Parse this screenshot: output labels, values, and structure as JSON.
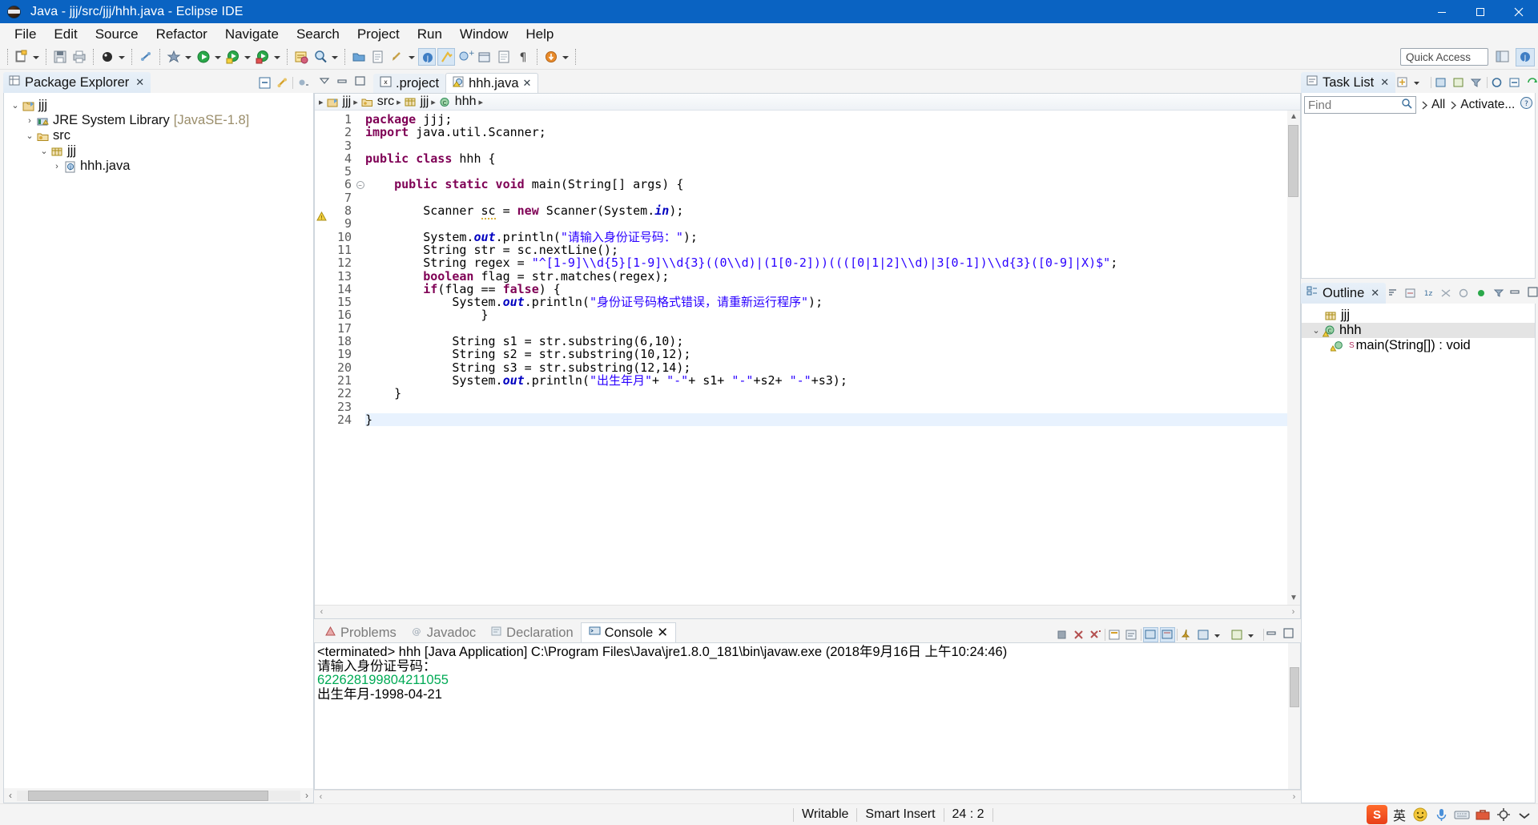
{
  "window": {
    "title": "Java - jjj/src/jjj/hhh.java - Eclipse IDE",
    "app_icon": "eclipse-icon",
    "minimize": "minimize-button",
    "maximize": "maximize-button",
    "close": "close-button",
    "titlebar_color": "#0a63c2"
  },
  "menu": {
    "items": [
      {
        "label": "File"
      },
      {
        "label": "Edit"
      },
      {
        "label": "Source"
      },
      {
        "label": "Refactor"
      },
      {
        "label": "Navigate"
      },
      {
        "label": "Search"
      },
      {
        "label": "Project"
      },
      {
        "label": "Run"
      },
      {
        "label": "Window"
      },
      {
        "label": "Help"
      }
    ]
  },
  "toolbar": {
    "quick_access_placeholder": "Quick Access",
    "icons": [
      "new-wizard-icon",
      "save-icon",
      "print-icon",
      "debug-icon",
      "link-icon",
      "build-icon",
      "run-last-icon",
      "debug-last-icon",
      "coverage-icon",
      "external-tools-icon",
      "search-icon",
      "open-type-icon",
      "next-annotation-icon",
      "previous-annotation-icon",
      "back-icon",
      "forward-icon",
      "java-perspective-icon",
      "toggle-breadcrumb-icon",
      "new-java-class-icon",
      "new-java-package-icon",
      "pilcrow-icon",
      "download-icon"
    ],
    "perspective_open": "open-perspective-icon",
    "perspective_java": "java-perspective-icon"
  },
  "package_explorer": {
    "title": "Package Explorer",
    "close_glyph": "✕",
    "actions": [
      "collapse-all-icon",
      "link-with-editor-icon",
      "view-menu-icon"
    ],
    "tree": [
      {
        "label": "jjj",
        "indent": 0,
        "twisty": "v",
        "icon": "java-project-icon",
        "suffix": ""
      },
      {
        "label": "JRE System Library",
        "indent": 1,
        "twisty": ">",
        "icon": "library-icon",
        "suffix": "[JavaSE-1.8]"
      },
      {
        "label": "src",
        "indent": 1,
        "twisty": "v",
        "icon": "source-folder-icon",
        "suffix": ""
      },
      {
        "label": "jjj",
        "indent": 2,
        "twisty": "v",
        "icon": "package-icon",
        "suffix": ""
      },
      {
        "label": "hhh.java",
        "indent": 3,
        "twisty": ">",
        "icon": "java-file-icon",
        "suffix": ""
      }
    ]
  },
  "editor": {
    "tabs": [
      {
        "label": ".project",
        "icon": "xml-file-icon",
        "active": false,
        "closable": false
      },
      {
        "label": "hhh.java",
        "icon": "java-warning-file-icon",
        "active": true,
        "closable": true
      }
    ],
    "breadcrumb": [
      {
        "label": "jjj",
        "icon": "java-project-icon"
      },
      {
        "label": "src",
        "icon": "source-folder-icon"
      },
      {
        "label": "jjj",
        "icon": "package-icon"
      },
      {
        "label": "hhh",
        "icon": "class-icon"
      }
    ],
    "current_line": 24,
    "lines": [
      {
        "n": 1,
        "fold": "",
        "marker": "",
        "tokens": [
          {
            "t": "package ",
            "c": "kw"
          },
          {
            "t": "jjj;",
            "c": ""
          }
        ]
      },
      {
        "n": 2,
        "fold": "",
        "marker": "",
        "tokens": [
          {
            "t": "import ",
            "c": "kw"
          },
          {
            "t": "java.util.Scanner;",
            "c": ""
          }
        ]
      },
      {
        "n": 3,
        "fold": "",
        "marker": "",
        "tokens": []
      },
      {
        "n": 4,
        "fold": "",
        "marker": "range",
        "tokens": [
          {
            "t": "public class ",
            "c": "kw"
          },
          {
            "t": "hhh {",
            "c": ""
          }
        ]
      },
      {
        "n": 5,
        "fold": "",
        "marker": "range",
        "tokens": []
      },
      {
        "n": 6,
        "fold": "-",
        "marker": "range",
        "tokens": [
          {
            "t": "    ",
            "c": ""
          },
          {
            "t": "public static void ",
            "c": "kw"
          },
          {
            "t": "main(String[] args) {",
            "c": ""
          }
        ]
      },
      {
        "n": 7,
        "fold": "",
        "marker": "range",
        "tokens": []
      },
      {
        "n": 8,
        "fold": "",
        "marker": "warning",
        "tokens": [
          {
            "t": "        Scanner ",
            "c": ""
          },
          {
            "t": "sc",
            "c": "wavy"
          },
          {
            "t": " = ",
            "c": ""
          },
          {
            "t": "new ",
            "c": "kw"
          },
          {
            "t": "Scanner(System.",
            "c": ""
          },
          {
            "t": "in",
            "c": "fld"
          },
          {
            "t": ");",
            "c": ""
          }
        ]
      },
      {
        "n": 9,
        "fold": "",
        "marker": "range",
        "tokens": []
      },
      {
        "n": 10,
        "fold": "",
        "marker": "range",
        "tokens": [
          {
            "t": "        System.",
            "c": ""
          },
          {
            "t": "out",
            "c": "fld"
          },
          {
            "t": ".println(",
            "c": ""
          },
          {
            "t": "\"请输入身份证号码：\"",
            "c": "str"
          },
          {
            "t": ");",
            "c": ""
          }
        ]
      },
      {
        "n": 11,
        "fold": "",
        "marker": "range",
        "tokens": [
          {
            "t": "        String str = sc.nextLine();",
            "c": ""
          }
        ]
      },
      {
        "n": 12,
        "fold": "",
        "marker": "range",
        "tokens": [
          {
            "t": "        String regex = ",
            "c": ""
          },
          {
            "t": "\"^[1-9]\\\\d{5}[1-9]\\\\d{3}((0\\\\d)|(1[0-2]))((([0|1|2]\\\\d)|3[0-1])\\\\d{3}([0-9]|X)$\"",
            "c": "str"
          },
          {
            "t": ";",
            "c": ""
          }
        ]
      },
      {
        "n": 13,
        "fold": "",
        "marker": "range",
        "tokens": [
          {
            "t": "        ",
            "c": ""
          },
          {
            "t": "boolean ",
            "c": "kw"
          },
          {
            "t": "flag = str.matches(regex);",
            "c": ""
          }
        ]
      },
      {
        "n": 14,
        "fold": "",
        "marker": "range",
        "tokens": [
          {
            "t": "        ",
            "c": ""
          },
          {
            "t": "if",
            "c": "kw"
          },
          {
            "t": "(flag == ",
            "c": ""
          },
          {
            "t": "false",
            "c": "kw"
          },
          {
            "t": ") {",
            "c": ""
          }
        ]
      },
      {
        "n": 15,
        "fold": "",
        "marker": "range",
        "tokens": [
          {
            "t": "            System.",
            "c": ""
          },
          {
            "t": "out",
            "c": "fld"
          },
          {
            "t": ".println(",
            "c": ""
          },
          {
            "t": "\"身份证号码格式错误，请重新运行程序\"",
            "c": "str"
          },
          {
            "t": ");",
            "c": ""
          }
        ]
      },
      {
        "n": 16,
        "fold": "",
        "marker": "range",
        "tokens": [
          {
            "t": "                }",
            "c": ""
          }
        ]
      },
      {
        "n": 17,
        "fold": "",
        "marker": "range",
        "tokens": []
      },
      {
        "n": 18,
        "fold": "",
        "marker": "range",
        "tokens": [
          {
            "t": "            String s1 = str.substring(6,10);",
            "c": ""
          }
        ]
      },
      {
        "n": 19,
        "fold": "",
        "marker": "range",
        "tokens": [
          {
            "t": "            String s2 = str.substring(10,12);",
            "c": ""
          }
        ]
      },
      {
        "n": 20,
        "fold": "",
        "marker": "range",
        "tokens": [
          {
            "t": "            String s3 = str.substring(12,14);",
            "c": ""
          }
        ]
      },
      {
        "n": 21,
        "fold": "",
        "marker": "range",
        "tokens": [
          {
            "t": "            System.",
            "c": ""
          },
          {
            "t": "out",
            "c": "fld"
          },
          {
            "t": ".println(",
            "c": ""
          },
          {
            "t": "\"出生年月\"",
            "c": "str"
          },
          {
            "t": "+ ",
            "c": ""
          },
          {
            "t": "\"-\"",
            "c": "str"
          },
          {
            "t": "+ s1+ ",
            "c": ""
          },
          {
            "t": "\"-\"",
            "c": "str"
          },
          {
            "t": "+s2+ ",
            "c": ""
          },
          {
            "t": "\"-\"",
            "c": "str"
          },
          {
            "t": "+s3);",
            "c": ""
          }
        ]
      },
      {
        "n": 22,
        "fold": "",
        "marker": "range",
        "tokens": [
          {
            "t": "    }",
            "c": ""
          }
        ]
      },
      {
        "n": 23,
        "fold": "",
        "marker": "",
        "tokens": []
      },
      {
        "n": 24,
        "fold": "",
        "marker": "",
        "tokens": [
          {
            "t": "}",
            "c": ""
          }
        ],
        "current": true
      }
    ]
  },
  "bottom_panel": {
    "tabs": [
      {
        "label": "Problems",
        "icon": "problems-icon",
        "active": false
      },
      {
        "label": "Javadoc",
        "icon": "javadoc-icon",
        "active": false
      },
      {
        "label": "Declaration",
        "icon": "declaration-icon",
        "active": false
      },
      {
        "label": "Console",
        "icon": "console-icon",
        "active": true,
        "closable": true
      }
    ],
    "actions": [
      "terminate-icon",
      "remove-launch-icon",
      "remove-all-terminated-icon",
      "clear-console-icon",
      "scroll-lock-icon",
      "word-wrap-icon",
      "show-console-on-output-icon",
      "pin-console-icon",
      "display-selected-console-icon",
      "open-console-icon",
      "view-menu-icon",
      "minimize-icon",
      "maximize-icon"
    ],
    "console": {
      "header": "<terminated> hhh [Java Application] C:\\Program Files\\Java\\jre1.8.0_181\\bin\\javaw.exe (2018年9月16日 上午10:24:46)",
      "lines": [
        {
          "text": "请输入身份证号码：",
          "color": "black"
        },
        {
          "text": "622628199804211055",
          "color": "#00aa55"
        },
        {
          "text": "出生年月-1998-04-21",
          "color": "black"
        }
      ]
    }
  },
  "task_list": {
    "title": "Task List",
    "find_placeholder": "Find",
    "all_label": "All",
    "activate_label": "Activate...",
    "actions": [
      "new-task-icon",
      "categorize-icon",
      "focus-icon",
      "filter-icon",
      "schedule-icon",
      "synchronize-icon",
      "view-menu-icon"
    ],
    "help_icon": "help-icon"
  },
  "outline": {
    "title": "Outline",
    "actions": [
      "sort-icon",
      "hide-fields-icon",
      "hide-static-icon",
      "hide-nonpublic-icon",
      "hide-local-types-icon",
      "link-icon",
      "view-menu-icon"
    ],
    "items": [
      {
        "label": "jjj",
        "icon": "package-icon",
        "indent": 0,
        "twisty": "",
        "selected": false,
        "sup": ""
      },
      {
        "label": "hhh",
        "icon": "class-warning-icon",
        "indent": 0,
        "twisty": "v",
        "selected": true,
        "sup": ""
      },
      {
        "label": "main(String[]) : void",
        "icon": "method-warning-icon",
        "indent": 1,
        "twisty": "",
        "selected": false,
        "sup": "S"
      }
    ]
  },
  "status_bar": {
    "writable": "Writable",
    "insert_mode": "Smart Insert",
    "position": "24 : 2",
    "tray_icons": [
      "sogou-logo-icon",
      "chinese-mode-icon",
      "emoji-icon",
      "microphone-icon",
      "keyboard-icon",
      "toolbox-icon",
      "settings-icon",
      "more-icon"
    ],
    "tray_cn_label": "英"
  }
}
